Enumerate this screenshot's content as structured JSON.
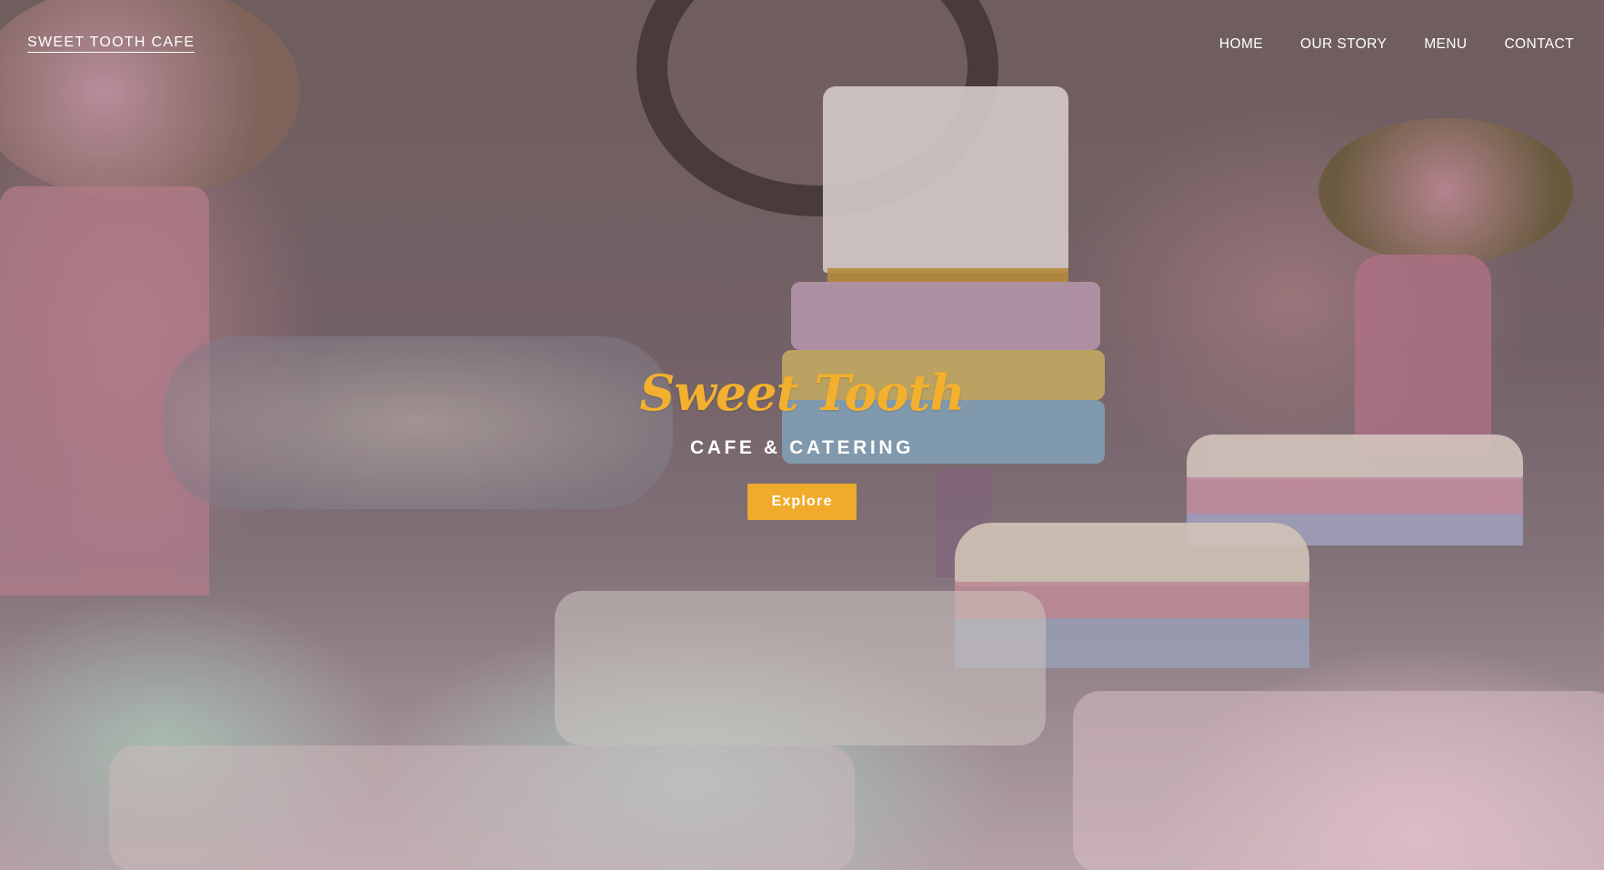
{
  "navbar": {
    "brand": "SWEET TOOTH CAFE",
    "links": [
      {
        "label": "HOME"
      },
      {
        "label": "OUR STORY"
      },
      {
        "label": "MENU"
      },
      {
        "label": "CONTACT"
      }
    ]
  },
  "hero": {
    "title": "Sweet Tooth",
    "subtitle": "CAFE & CATERING",
    "button_label": "Explore",
    "background_image": "desserts-party-table-photo"
  },
  "colors": {
    "accent": "#f0ab2c",
    "title": "#f2b02e",
    "nav_text": "#ffffff"
  }
}
